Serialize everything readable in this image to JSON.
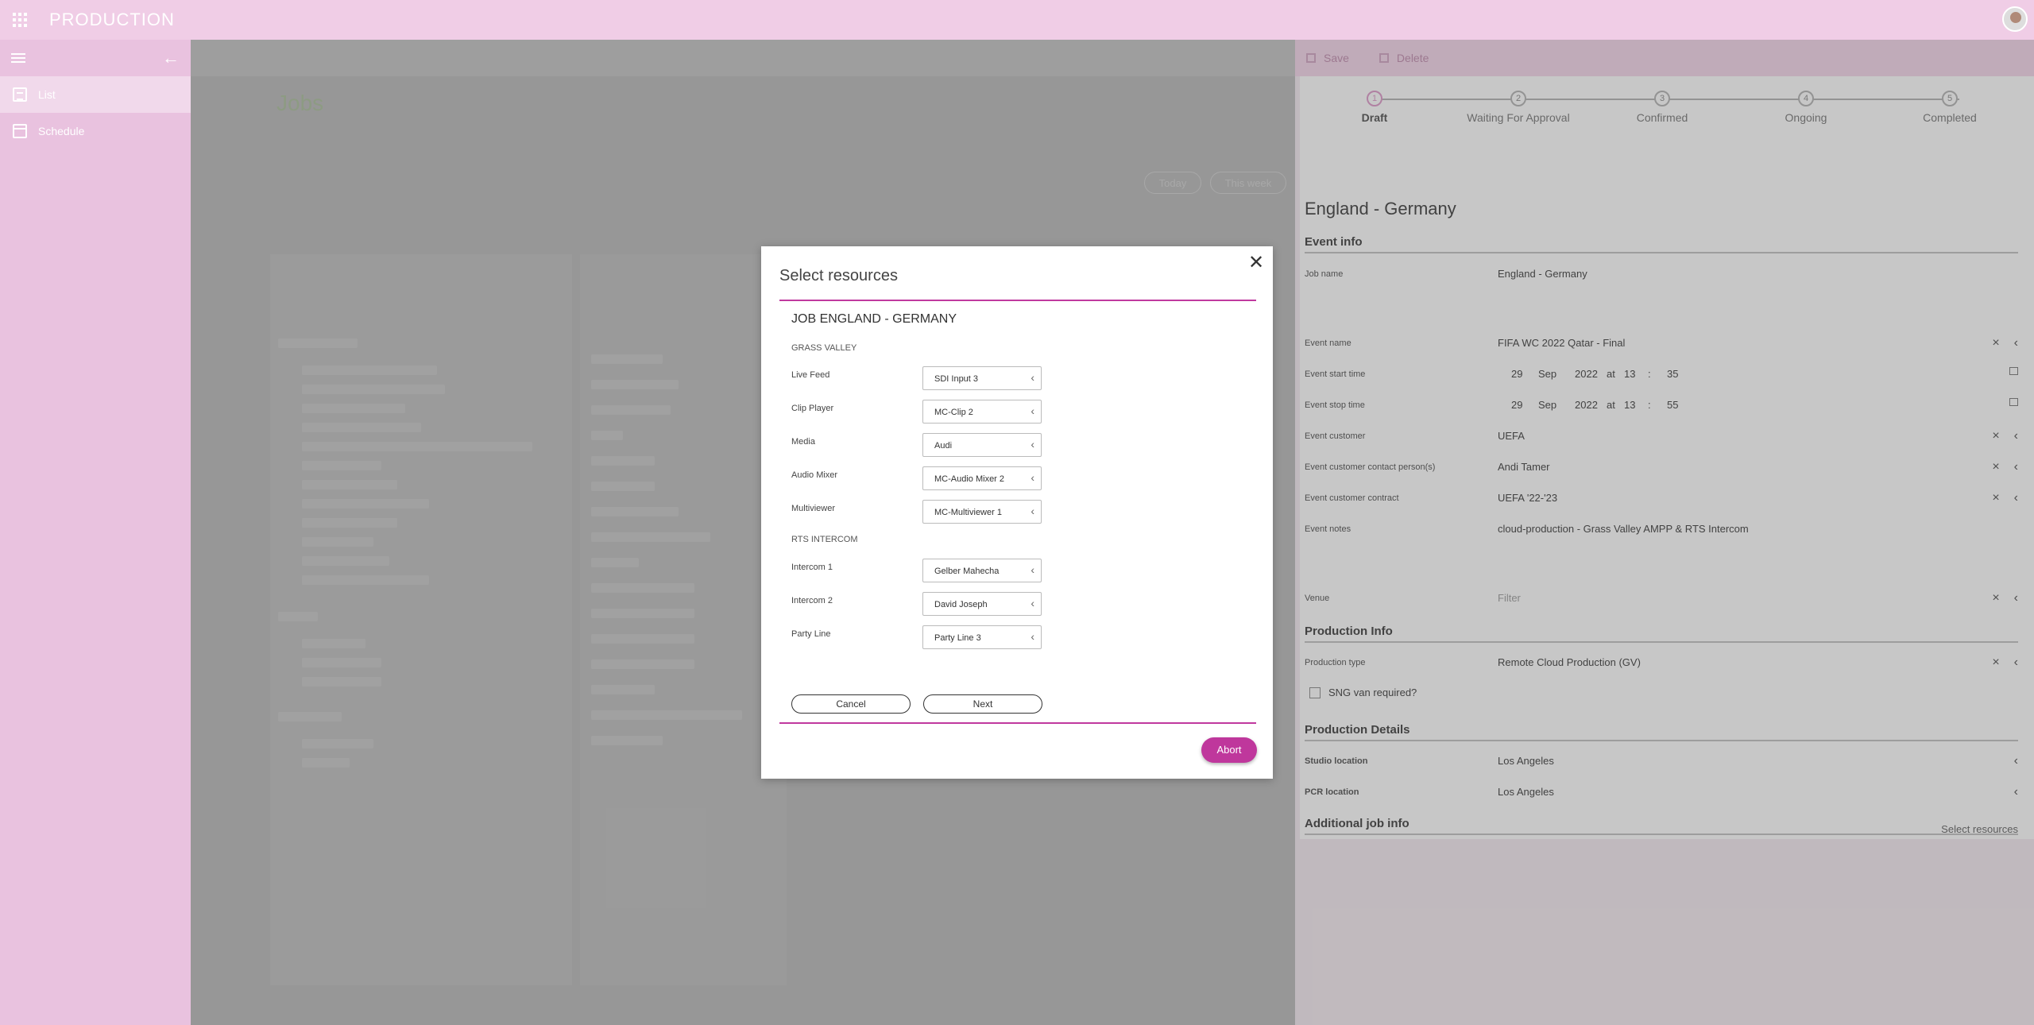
{
  "app": {
    "title": "PRODUCTION"
  },
  "sidebar": {
    "items": [
      {
        "label": "List"
      },
      {
        "label": "Schedule"
      }
    ]
  },
  "jobs": {
    "title": "Jobs",
    "today_label": "Today",
    "this_week_label": "This week"
  },
  "right_panel": {
    "save_label": "Save",
    "delete_label": "Delete",
    "steps": [
      {
        "num": "1",
        "label": "Draft"
      },
      {
        "num": "2",
        "label": "Waiting For Approval"
      },
      {
        "num": "3",
        "label": "Confirmed"
      },
      {
        "num": "4",
        "label": "Ongoing"
      },
      {
        "num": "5",
        "label": "Completed"
      }
    ],
    "title": "England - Germany",
    "event_info_title": "Event info",
    "fields": {
      "job_name": {
        "label": "Job name",
        "value": "England - Germany"
      },
      "event_name": {
        "label": "Event name",
        "value": "FIFA WC 2022 Qatar - Final"
      },
      "event_start": {
        "label": "Event start time",
        "day": "29",
        "month": "Sep",
        "year": "2022",
        "at": "at",
        "hour": "13",
        "sep": ":",
        "minute": "35"
      },
      "event_stop": {
        "label": "Event stop time",
        "day": "29",
        "month": "Sep",
        "year": "2022",
        "at": "at",
        "hour": "13",
        "sep": ":",
        "minute": "55"
      },
      "event_customer": {
        "label": "Event customer",
        "value": "UEFA"
      },
      "event_contact": {
        "label": "Event customer contact person(s)",
        "value": "Andi Tamer"
      },
      "event_contract": {
        "label": "Event customer contract",
        "value": "UEFA '22-'23"
      },
      "event_notes": {
        "label": "Event notes",
        "value": "cloud-production - Grass Valley AMPP & RTS Intercom"
      },
      "venue": {
        "label": "Venue",
        "placeholder": "Filter"
      },
      "production_type": {
        "label": "Production type",
        "value": "Remote Cloud Production (GV)"
      },
      "studio_location": {
        "label": "Studio location",
        "value": "Los Angeles"
      },
      "pcr_location": {
        "label": "PCR location",
        "value": "Los Angeles"
      }
    },
    "production_info_title": "Production Info",
    "sng_label": "SNG van required?",
    "production_details_title": "Production Details",
    "additional_info_title": "Additional job info",
    "select_resources_link": "Select resources"
  },
  "modal": {
    "title": "Select resources",
    "job_heading": "JOB ENGLAND - GERMANY",
    "groups": [
      {
        "name": "GRASS VALLEY",
        "rows": [
          {
            "label": "Live Feed",
            "value": "SDI Input 3"
          },
          {
            "label": "Clip Player",
            "value": "MC-Clip 2"
          },
          {
            "label": "Media",
            "value": "Audi"
          },
          {
            "label": "Audio Mixer",
            "value": "MC-Audio Mixer 2"
          },
          {
            "label": "Multiviewer",
            "value": "MC-Multiviewer 1"
          }
        ]
      },
      {
        "name": "RTS INTERCOM",
        "rows": [
          {
            "label": "Intercom 1",
            "value": "Gelber Mahecha"
          },
          {
            "label": "Intercom 2",
            "value": "David Joseph"
          },
          {
            "label": "Party Line",
            "value": "Party Line 3"
          }
        ]
      }
    ],
    "cancel_label": "Cancel",
    "next_label": "Next",
    "abort_label": "Abort"
  }
}
